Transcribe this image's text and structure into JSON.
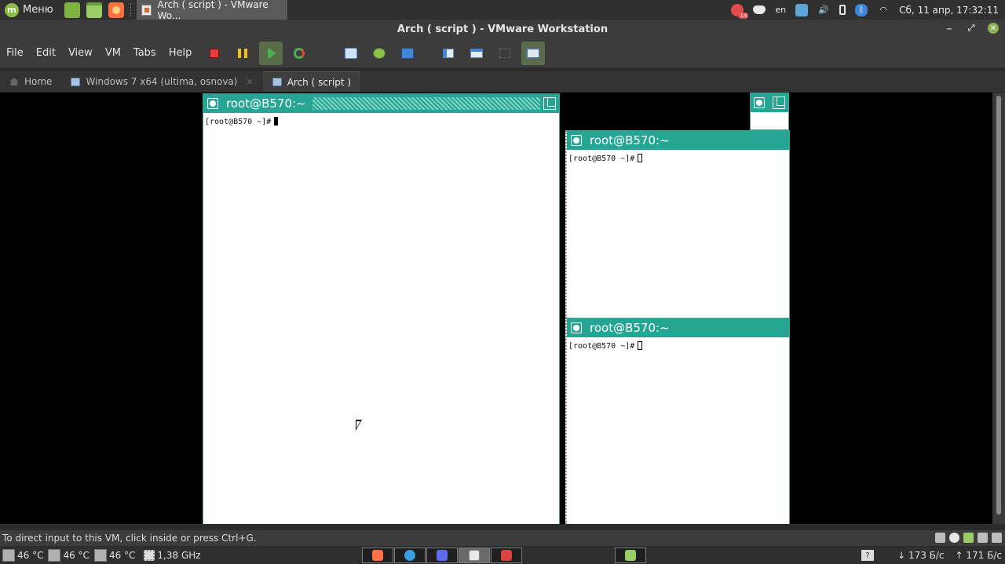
{
  "top_panel": {
    "menu_label": "Меню",
    "active_task": "Arch ( script ) - VMware Wo...",
    "tray": {
      "telegram_badge": "14",
      "language": "en",
      "clock": "Сб, 11 апр, 17:32:11"
    }
  },
  "window": {
    "title": "Arch ( script ) - VMware Workstation",
    "controls": {
      "minimize": "‒",
      "restore": "⤢",
      "close": "✕"
    }
  },
  "menubar": {
    "items": [
      "File",
      "Edit",
      "View",
      "VM",
      "Tabs",
      "Help"
    ]
  },
  "tabs": [
    {
      "label": "Home"
    },
    {
      "label": "Windows 7 x64 (ultima, osnova)"
    },
    {
      "label": "Arch ( script )"
    }
  ],
  "vm": {
    "terminals": [
      {
        "title": "root@B570:~",
        "prompt": "[root@B570 ~]#"
      },
      {
        "title": "root@B570:~",
        "prompt": "[root@B570 ~]#"
      },
      {
        "title": "root@B570:~",
        "prompt": "[root@B570 ~]#"
      }
    ]
  },
  "statusbar": {
    "message": "To direct input to this VM, click inside or press Ctrl+G."
  },
  "bottom_panel": {
    "sensors": [
      "46 °C",
      "46 °C",
      "46 °C"
    ],
    "cpu_freq": "1,38 GHz",
    "net_down": "173 Б/с",
    "net_up": "171 Б/с"
  },
  "colors": {
    "terminal_titlebar": "#26a594",
    "mint_green": "#8fbb48"
  }
}
